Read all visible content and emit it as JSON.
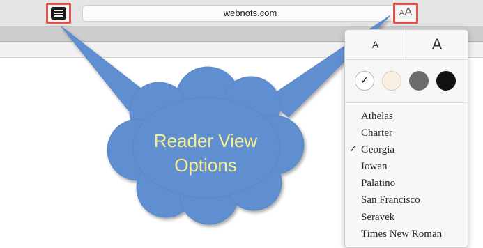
{
  "browser": {
    "url": "webnots.com",
    "reader_icon": "reader-view-icon",
    "text_size_button": {
      "small": "A",
      "large": "A"
    }
  },
  "reader_options": {
    "font_size": {
      "smaller_label": "A",
      "larger_label": "A"
    },
    "themes": [
      {
        "name": "white",
        "color": "#ffffff",
        "selected": true,
        "check": "✓"
      },
      {
        "name": "sepia",
        "color": "#f8efe1",
        "selected": false
      },
      {
        "name": "gray",
        "color": "#6b6b6b",
        "selected": false
      },
      {
        "name": "night",
        "color": "#111111",
        "selected": false
      }
    ],
    "fonts": [
      "Athelas",
      "Charter",
      "Georgia",
      "Iowan",
      "Palatino",
      "San Francisco",
      "Seravek",
      "Times New Roman"
    ],
    "selected_font": "Georgia",
    "check_mark": "✓"
  },
  "callout": {
    "line1": "Reader View",
    "line2": "Options",
    "fill_color": "#5e8fd1",
    "highlight_color": "#e0504a"
  }
}
